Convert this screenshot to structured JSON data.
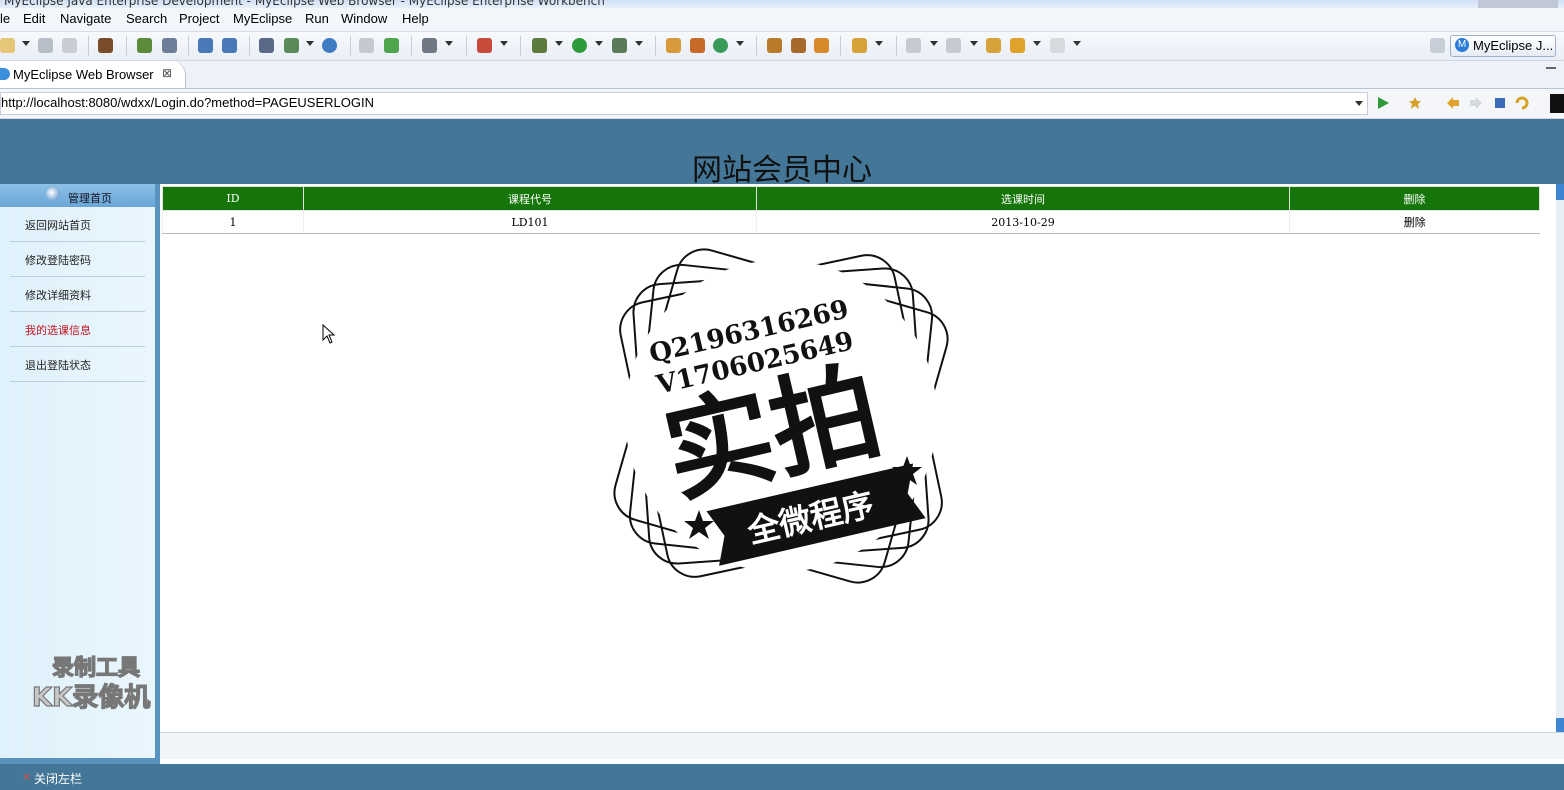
{
  "window": {
    "title": "MyEclipse Java Enterprise Development - MyEclipse Web Browser - MyEclipse Enterprise Workbench"
  },
  "menu": [
    "le",
    "Edit",
    "Navigate",
    "Search",
    "Project",
    "MyEclipse",
    "Run",
    "Window",
    "Help"
  ],
  "perspective": {
    "label": "MyEclipse J...",
    "icon": "M"
  },
  "editor_tab": {
    "label": "MyEclipse Web Browser",
    "close": "⊠"
  },
  "browser": {
    "url": "http://localhost:8080/wdxx/Login.do?method=PAGEUSERLOGIN"
  },
  "page": {
    "title": "网站会员中心",
    "sidebar": {
      "header": "管理首页",
      "items": [
        {
          "label": "返回网站首页"
        },
        {
          "label": "修改登陆密码"
        },
        {
          "label": "修改详细资料"
        },
        {
          "label": "我的选课信息",
          "active": true
        },
        {
          "label": "退出登陆状态"
        }
      ]
    },
    "table": {
      "headers": [
        "ID",
        "课程代号",
        "选课时间",
        "删除"
      ],
      "rows": [
        [
          "1",
          "LD101",
          "2013-10-29",
          "删除"
        ]
      ]
    },
    "footer": {
      "close_icon": "×",
      "label": "关闭左栏"
    }
  },
  "stamp": {
    "line1": "Q2196316269",
    "line2": "V1706025649",
    "main": "实拍",
    "ribbon": "全微程序"
  },
  "watermark": {
    "line1": "录制工具",
    "line2": "KK录像机"
  },
  "colors": {
    "header_bg": "#447797",
    "table_header": "#157509",
    "active_item": "#c0141e"
  }
}
